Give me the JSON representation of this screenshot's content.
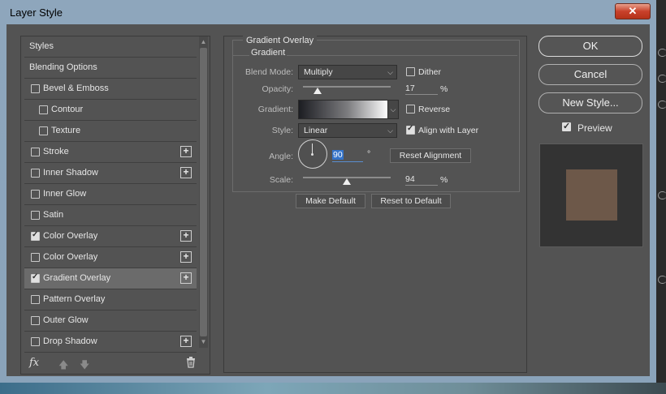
{
  "window": {
    "title": "Layer Style",
    "close_label": "✕"
  },
  "sidebar": {
    "items": [
      {
        "label": "Styles",
        "checkbox": false,
        "checked": false,
        "plus": false,
        "indent": 0,
        "selected": false
      },
      {
        "label": "Blending Options",
        "checkbox": false,
        "checked": false,
        "plus": false,
        "indent": 0,
        "selected": false
      },
      {
        "label": "Bevel & Emboss",
        "checkbox": true,
        "checked": false,
        "plus": false,
        "indent": 0,
        "selected": false
      },
      {
        "label": "Contour",
        "checkbox": true,
        "checked": false,
        "plus": false,
        "indent": 1,
        "selected": false
      },
      {
        "label": "Texture",
        "checkbox": true,
        "checked": false,
        "plus": false,
        "indent": 1,
        "selected": false
      },
      {
        "label": "Stroke",
        "checkbox": true,
        "checked": false,
        "plus": true,
        "indent": 0,
        "selected": false
      },
      {
        "label": "Inner Shadow",
        "checkbox": true,
        "checked": false,
        "plus": true,
        "indent": 0,
        "selected": false
      },
      {
        "label": "Inner Glow",
        "checkbox": true,
        "checked": false,
        "plus": false,
        "indent": 0,
        "selected": false
      },
      {
        "label": "Satin",
        "checkbox": true,
        "checked": false,
        "plus": false,
        "indent": 0,
        "selected": false
      },
      {
        "label": "Color Overlay",
        "checkbox": true,
        "checked": true,
        "plus": true,
        "indent": 0,
        "selected": false
      },
      {
        "label": "Color Overlay",
        "checkbox": true,
        "checked": false,
        "plus": true,
        "indent": 0,
        "selected": false
      },
      {
        "label": "Gradient Overlay",
        "checkbox": true,
        "checked": true,
        "plus": true,
        "indent": 0,
        "selected": true
      },
      {
        "label": "Pattern Overlay",
        "checkbox": true,
        "checked": false,
        "plus": false,
        "indent": 0,
        "selected": false
      },
      {
        "label": "Outer Glow",
        "checkbox": true,
        "checked": false,
        "plus": false,
        "indent": 0,
        "selected": false
      },
      {
        "label": "Drop Shadow",
        "checkbox": true,
        "checked": false,
        "plus": true,
        "indent": 0,
        "selected": false
      }
    ],
    "footer": {
      "fx_label": "fx",
      "move_up": "🡅",
      "move_down": "🡇"
    }
  },
  "gradient_overlay": {
    "group_title": "Gradient Overlay",
    "subgroup_title": "Gradient",
    "blend_mode": {
      "label": "Blend Mode:",
      "value": "Multiply"
    },
    "dither": {
      "label": "Dither",
      "checked": false
    },
    "opacity": {
      "label": "Opacity:",
      "value": "17",
      "unit": "%",
      "fraction": 0.17
    },
    "gradient": {
      "label": "Gradient:"
    },
    "reverse": {
      "label": "Reverse",
      "checked": false
    },
    "style": {
      "label": "Style:",
      "value": "Linear"
    },
    "align_with_layer": {
      "label": "Align with Layer",
      "checked": true
    },
    "angle": {
      "label": "Angle:",
      "value": "90",
      "unit": "°"
    },
    "reset_alignment": "Reset Alignment",
    "scale": {
      "label": "Scale:",
      "value": "94",
      "unit": "%",
      "fraction": 0.5
    },
    "make_default": "Make Default",
    "reset_to_default": "Reset to Default"
  },
  "actions": {
    "ok": "OK",
    "cancel": "Cancel",
    "new_style": "New Style...",
    "preview_label": "Preview",
    "preview_checked": true
  },
  "colors": {
    "preview_swatch": "#6d5849",
    "dialog_bg": "#535353",
    "selected_row": "#6b6b6b"
  }
}
